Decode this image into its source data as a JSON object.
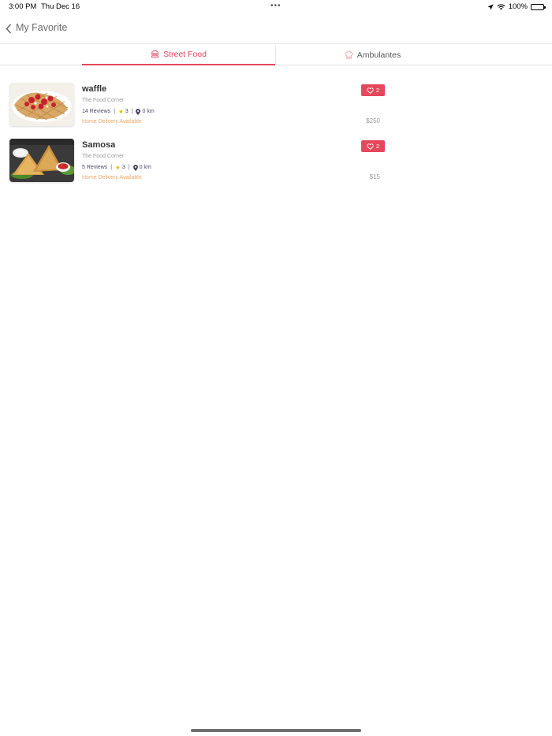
{
  "status_bar": {
    "time": "3:00 PM",
    "date": "Thu Dec 16",
    "battery": "100%",
    "battery_level": 1.0,
    "icons": [
      "location-arrow-icon",
      "wifi-icon",
      "battery-icon"
    ]
  },
  "nav": {
    "title": "My Favorite",
    "back_icon": "chevron-left-icon"
  },
  "tabs": [
    {
      "label": "Street Food",
      "icon": "burger-icon",
      "active": true
    },
    {
      "label": "Ambulantes",
      "icon": "chef-hat-icon",
      "active": false
    }
  ],
  "colors": {
    "accent": "#e5475b",
    "delivery": "#f0a66b",
    "star": "#f5b400"
  },
  "items": [
    {
      "name": "waffle",
      "vendor": "The Food Corner",
      "reviews": "14 Reviews",
      "rating": "3",
      "distance": "0 km",
      "delivery": "Home Delivery Available",
      "favorites": "2",
      "price": "$250",
      "image": "waffle-image"
    },
    {
      "name": "Samosa",
      "vendor": "The Food Corner",
      "reviews": "5 Reviews",
      "rating": "3",
      "distance": "0 km",
      "delivery": "Home Delivery Available",
      "favorites": "2",
      "price": "$15",
      "image": "samosa-image"
    }
  ]
}
